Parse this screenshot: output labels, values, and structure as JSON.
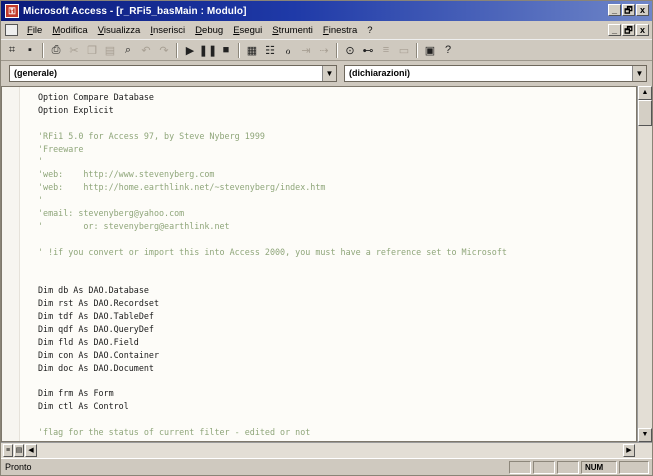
{
  "window": {
    "title": "Microsoft Access - [r_RFi5_basMain : Modulo]"
  },
  "window_controls": {
    "minimize": "_",
    "restore": "🗗",
    "close": "x"
  },
  "menu": [
    "File",
    "Modifica",
    "Visualizza",
    "Inserisci",
    "Debug",
    "Esegui",
    "Strumenti",
    "Finestra",
    "?"
  ],
  "combos": {
    "object": "(generale)",
    "procedure": "(dichiarazioni)"
  },
  "code_lines": [
    {
      "text": "Option Compare Database",
      "comment": false
    },
    {
      "text": "Option Explicit",
      "comment": false
    },
    {
      "text": "",
      "comment": false
    },
    {
      "text": "'RFi1 5.0 for Access 97, by Steve Nyberg 1999",
      "comment": true
    },
    {
      "text": "'Freeware",
      "comment": true
    },
    {
      "text": "'",
      "comment": true
    },
    {
      "text": "'web:    http://www.stevenyberg.com",
      "comment": true
    },
    {
      "text": "'web:    http://home.earthlink.net/~stevenyberg/index.htm",
      "comment": true
    },
    {
      "text": "'",
      "comment": true
    },
    {
      "text": "'email: stevenyberg@yahoo.com",
      "comment": true
    },
    {
      "text": "'        or: stevenyberg@earthlink.net",
      "comment": true
    },
    {
      "text": "",
      "comment": false
    },
    {
      "text": "' !if you convert or import this into Access 2000, you must have a reference set to Microsoft",
      "comment": true
    },
    {
      "text": "",
      "comment": false
    },
    {
      "text": "",
      "comment": false
    },
    {
      "text": "Dim db As DAO.Database",
      "comment": false
    },
    {
      "text": "Dim rst As DAO.Recordset",
      "comment": false
    },
    {
      "text": "Dim tdf As DAO.TableDef",
      "comment": false
    },
    {
      "text": "Dim qdf As DAO.QueryDef",
      "comment": false
    },
    {
      "text": "Dim fld As DAO.Field",
      "comment": false
    },
    {
      "text": "Dim con As DAO.Container",
      "comment": false
    },
    {
      "text": "Dim doc As DAO.Document",
      "comment": false
    },
    {
      "text": "",
      "comment": false
    },
    {
      "text": "Dim frm As Form",
      "comment": false
    },
    {
      "text": "Dim ctl As Control",
      "comment": false
    },
    {
      "text": "",
      "comment": false
    },
    {
      "text": "'flag for the status of current filter - edited or not",
      "comment": true
    }
  ],
  "status": {
    "text": "Pronto",
    "num": "NUM"
  },
  "colors": {
    "title_start": "#0a1a7a",
    "comment": "#8fa67a",
    "code_bg": "#fdfcf8"
  }
}
